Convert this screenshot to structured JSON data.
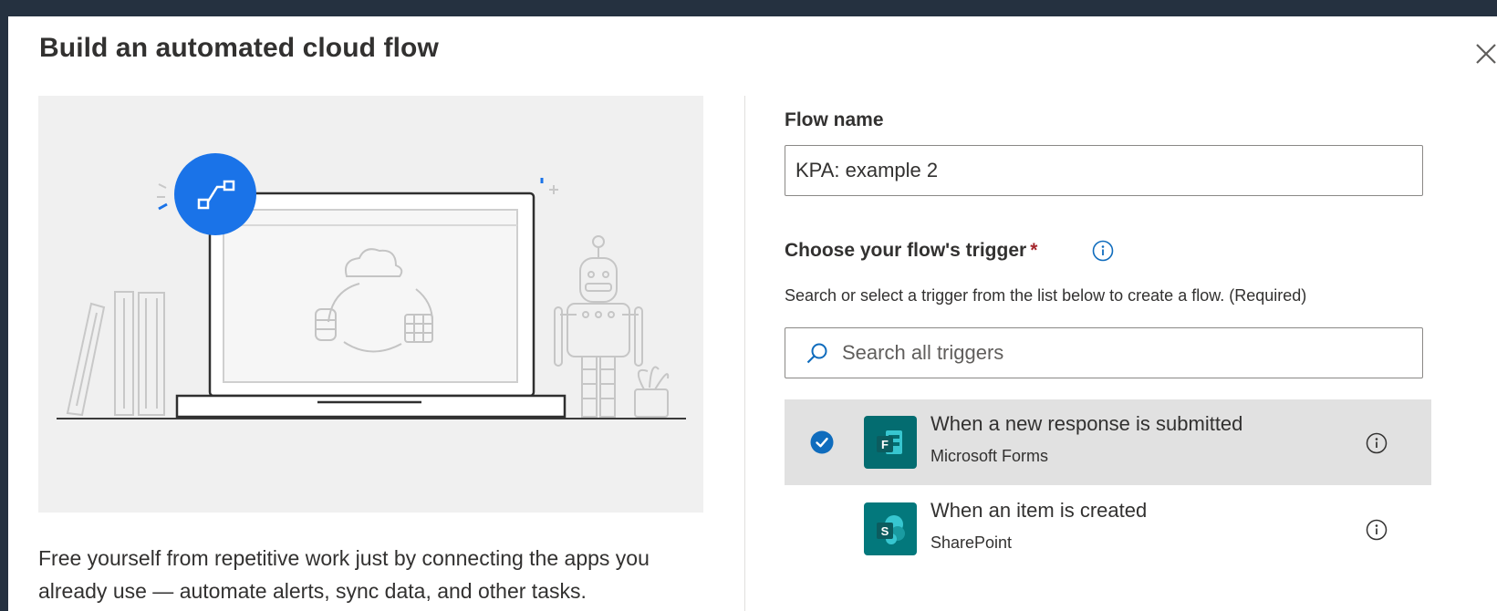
{
  "dialog": {
    "title": "Build an automated cloud flow",
    "description": "Free yourself from repetitive work just by connecting the apps you already use — automate alerts, sync data, and other tasks."
  },
  "form": {
    "flow_name_label": "Flow name",
    "flow_name_value": "KPA: example 2",
    "trigger_label": "Choose your flow's trigger",
    "required_marker": "*",
    "trigger_hint": "Search or select a trigger from the list below to create a flow. (Required)",
    "search_placeholder": "Search all triggers"
  },
  "triggers": [
    {
      "name": "When a new response is submitted",
      "app": "Microsoft Forms",
      "selected": true,
      "tile_color": "#036c70",
      "tile_letter": "F"
    },
    {
      "name": "When an item is created",
      "app": "SharePoint",
      "selected": false,
      "tile_color": "#03787c",
      "tile_letter": "S"
    }
  ],
  "colors": {
    "accent": "#0f6cbd",
    "backdrop": "#253140",
    "selected_row": "#e1e1e1",
    "required": "#a4262c",
    "illustration_bg": "#f0f0f0"
  },
  "icons": [
    "close-icon",
    "info-icon",
    "search-icon",
    "checkmark-icon",
    "microsoft-forms-icon",
    "sharepoint-icon",
    "flow-connector-icon",
    "laptop-illustration",
    "robot-illustration",
    "books-illustration",
    "plant-illustration"
  ]
}
